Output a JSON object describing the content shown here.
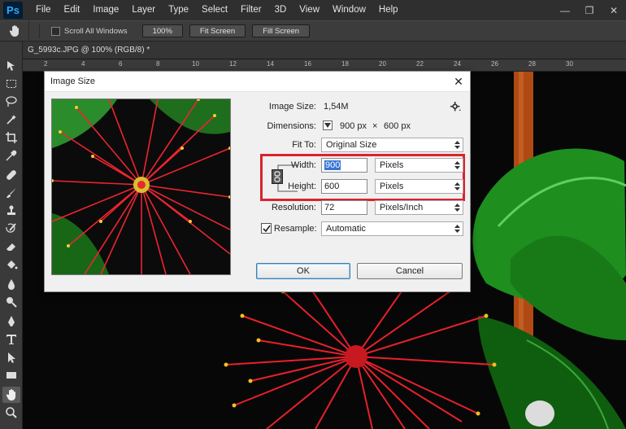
{
  "app": {
    "logo_text": "Ps",
    "menu": [
      "File",
      "Edit",
      "Image",
      "Layer",
      "Type",
      "Select",
      "Filter",
      "3D",
      "View",
      "Window",
      "Help"
    ]
  },
  "options_bar": {
    "scroll_all_windows": "Scroll All Windows",
    "zoom_100": "100%",
    "fit_screen": "Fit Screen",
    "fill_screen": "Fill Screen"
  },
  "document": {
    "tab_title": "G_5993c.JPG @ 100% (RGB/8) *",
    "ruler_labels": [
      "2",
      "4",
      "6",
      "8",
      "10",
      "12",
      "14",
      "16",
      "18",
      "20",
      "22",
      "24",
      "26",
      "28",
      "30"
    ]
  },
  "dialog": {
    "title": "Image Size",
    "image_size_label": "Image Size:",
    "image_size_value": "1,54M",
    "dimensions_label": "Dimensions:",
    "dimensions_width": "900 px",
    "dimensions_times": "×",
    "dimensions_height": "600 px",
    "fit_to_label": "Fit To:",
    "fit_to_value": "Original Size",
    "width_label": "Width:",
    "width_value": "900",
    "width_unit": "Pixels",
    "height_label": "Height:",
    "height_value": "600",
    "height_unit": "Pixels",
    "resolution_label": "Resolution:",
    "resolution_value": "72",
    "resolution_unit": "Pixels/Inch",
    "resample_label": "Resample:",
    "resample_checked": true,
    "resample_value": "Automatic",
    "ok_label": "OK",
    "cancel_label": "Cancel"
  },
  "colors": {
    "highlight_box": "#d9232d",
    "selection": "#3875d7",
    "app_bg": "#282828"
  }
}
